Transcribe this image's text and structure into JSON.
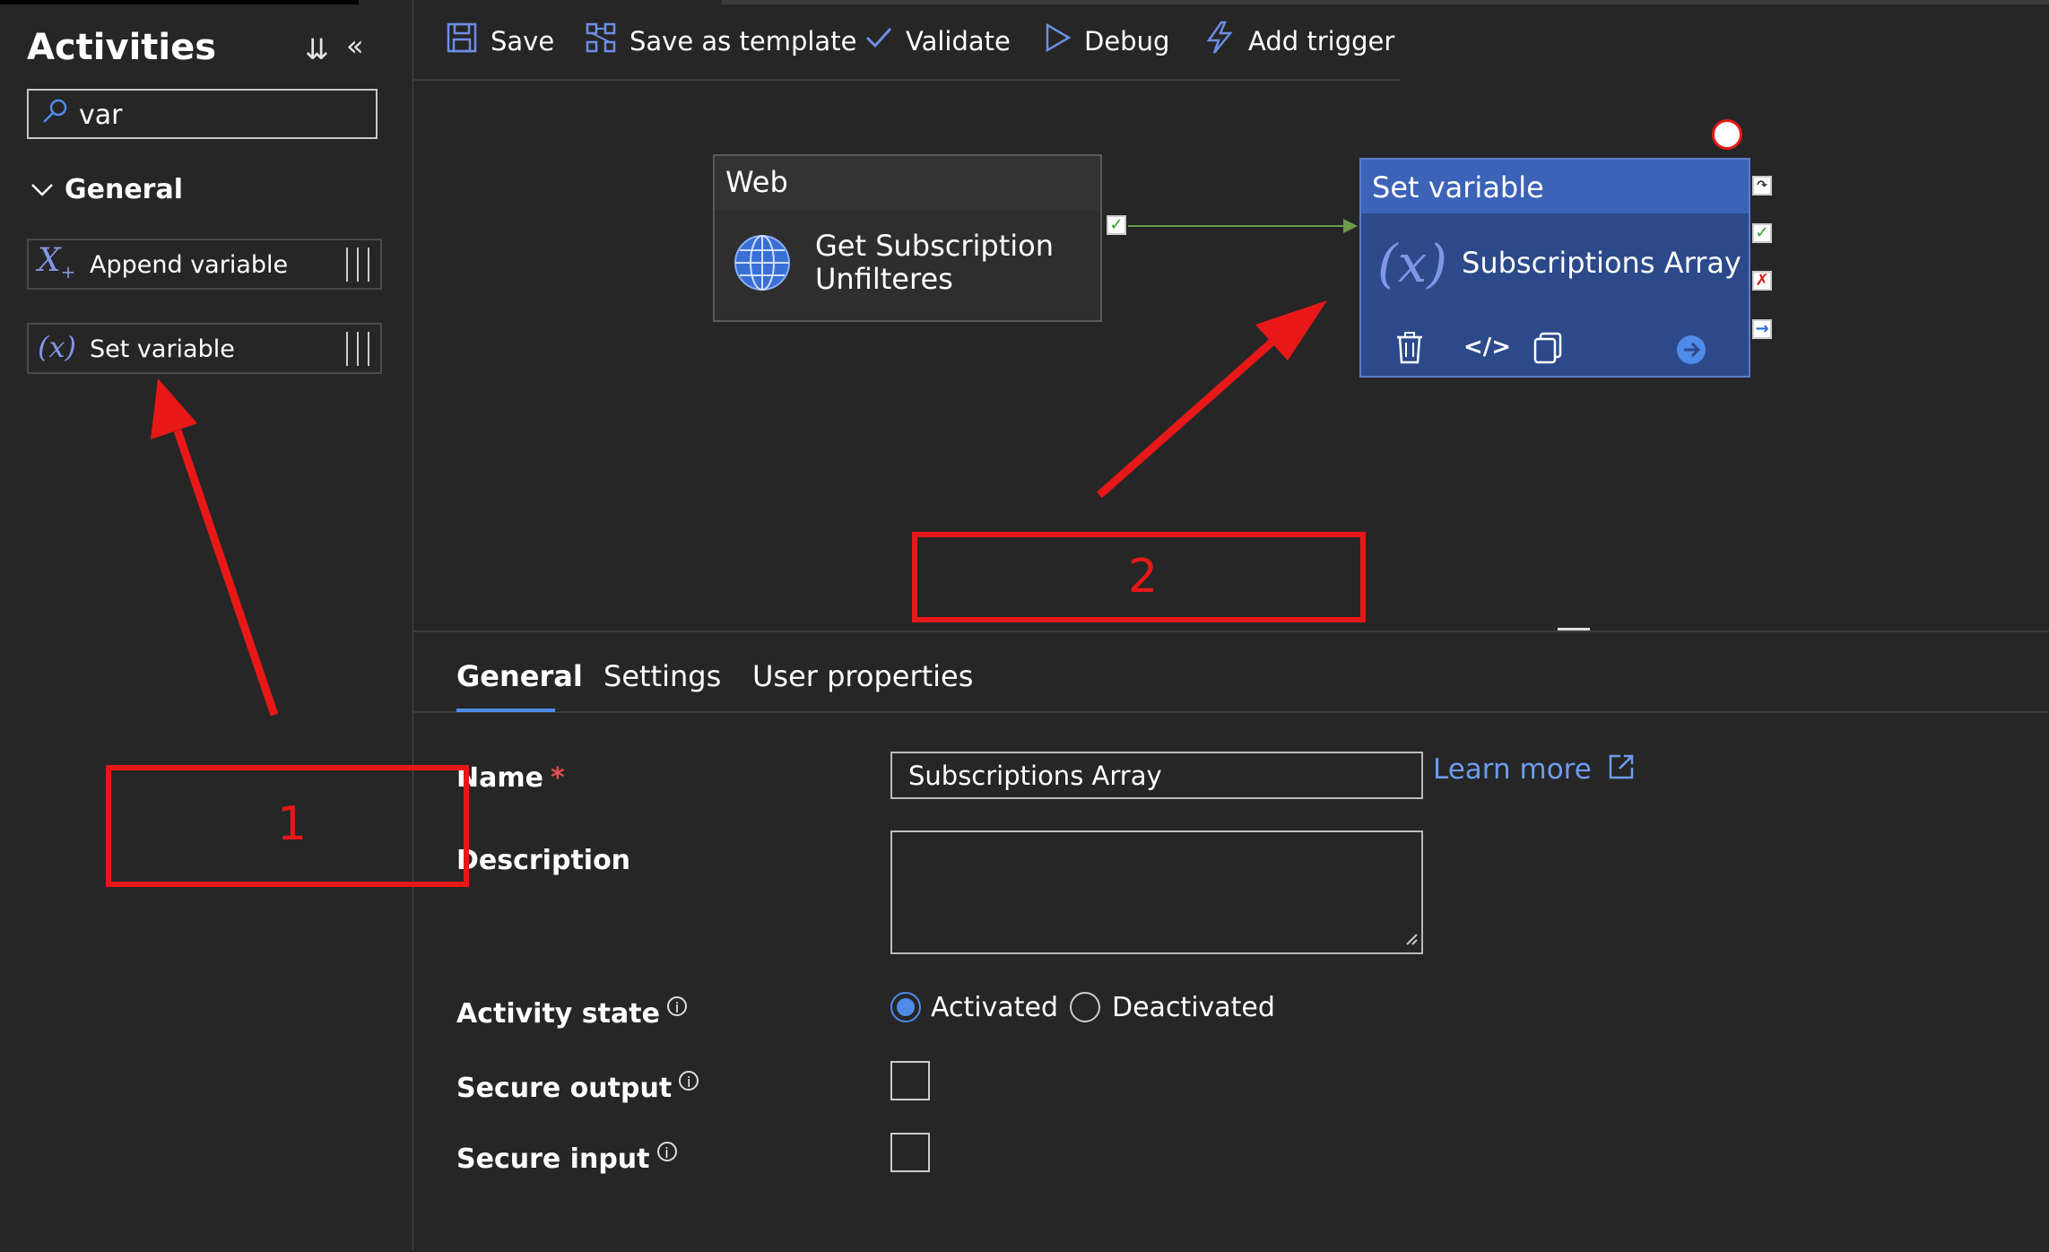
{
  "activities": {
    "title": "Activities",
    "search_value": "var",
    "group": "General",
    "items": [
      {
        "label": "Append variable",
        "icon": "append-variable-icon"
      },
      {
        "label": "Set variable",
        "icon": "set-variable-icon"
      }
    ]
  },
  "toolbar": {
    "save": "Save",
    "save_template": "Save as template",
    "validate": "Validate",
    "debug": "Debug",
    "add_trigger": "Add trigger"
  },
  "canvas": {
    "web_node": {
      "type": "Web",
      "name_line1": "Get Subscription",
      "name_line2": "Unfilteres"
    },
    "set_node": {
      "type": "Set variable",
      "name": "Subscriptions Array"
    }
  },
  "tabs": [
    "General",
    "Settings",
    "User properties"
  ],
  "general": {
    "name_label": "Name",
    "required_mark": "*",
    "name_value": "Subscriptions Array",
    "learn_more": "Learn more",
    "description_label": "Description",
    "activity_state_label": "Activity state",
    "activated": "Activated",
    "deactivated": "Deactivated",
    "secure_output_label": "Secure output",
    "secure_input_label": "Secure input"
  },
  "annotations": {
    "box1": "1",
    "box2": "2"
  },
  "colors": {
    "accent": "#4f8be8",
    "annotation_red": "#e81818",
    "node_blue": "#3c63b8"
  }
}
